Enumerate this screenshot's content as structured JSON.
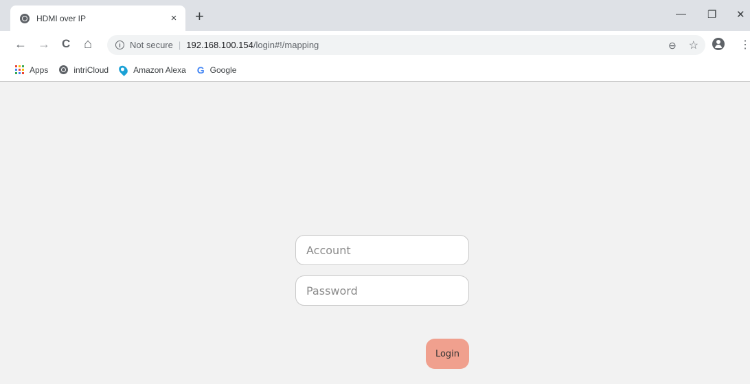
{
  "browser": {
    "tab": {
      "title": "HDMI over IP",
      "close": "×"
    },
    "new_tab": "+",
    "window": {
      "minimize": "—",
      "restore": "❐",
      "close": "✕"
    },
    "nav": {
      "back": "←",
      "forward": "→",
      "reload": "C",
      "home": "⌂"
    },
    "omnibox": {
      "info": "i",
      "security_label": "Not secure",
      "separator": "|",
      "host": "192.168.100.154",
      "path": "/login#!/mapping",
      "zoom": "⊖",
      "star": "☆"
    },
    "menu": "⋮",
    "bookmarks": [
      {
        "label": "Apps"
      },
      {
        "label": "intriCloud"
      },
      {
        "label": "Amazon Alexa"
      },
      {
        "label": "Google",
        "icon_letter": "G"
      }
    ]
  },
  "login": {
    "account_placeholder": "Account",
    "password_placeholder": "Password",
    "button_label": "Login"
  },
  "colors": {
    "page_bg": "#f2f2f2",
    "login_button": "#f0a08e",
    "tabstrip": "#dee1e6"
  }
}
